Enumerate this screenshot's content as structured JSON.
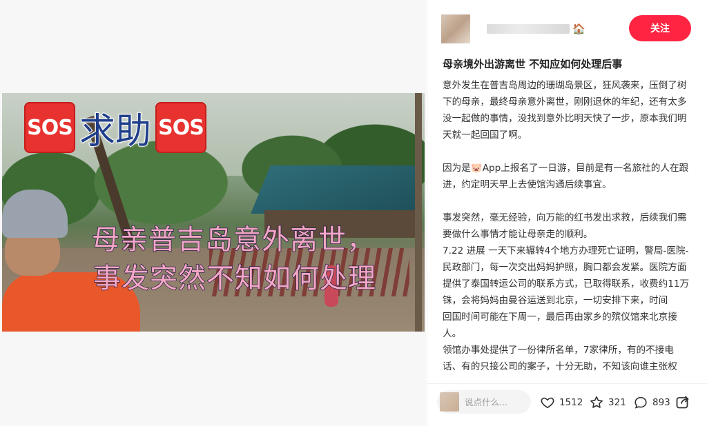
{
  "media": {
    "sos_badge": "SOS",
    "sos_text": "求助",
    "overlay_line1": "母亲普吉岛意外离世，",
    "overlay_line2": "事发突然不知如何处理"
  },
  "author": {
    "follow_label": "关注"
  },
  "post": {
    "title": "母亲境外出游离世 不知应如何处理后事",
    "paragraphs": [
      "意外发生在普吉岛周边的珊瑚岛景区，狂风袭来，压倒了树下的母亲，最终母亲意外离世，刚刚退休的年纪，还有太多没一起做的事情，没找到意外比明天快了一步，原本我们明天就一起回国了啊。",
      "因为是🐷App上报名了一日游，目前是有一名旅社的人在跟进，约定明天早上去使馆沟通后续事宜。",
      "事发突然，毫无经验，向万能的红书发出求救，后续我们需要做什么事情才能让母亲走的顺利。",
      "7.22 进展 一天下来辗转4个地方办理死亡证明，警局-医院-民政部门，每一次交出妈妈护照，胸口都会发紧。医院方面提供了泰国转运公司的联系方式，已取得联系，收费约11万铢，会将妈妈由曼谷运送到北京，一切安排下来，时间",
      "回国时间可能在下周一，最后再由家乡的殡仪馆来北京接人。",
      "领馆办事处提供了一份律所名单，7家律所，有的不接电话、有的只接公司的案子，十分无助，不知该向谁主张权利。"
    ]
  },
  "actions": {
    "comment_placeholder": "说点什么...",
    "likes": "1512",
    "stars": "321",
    "comments": "893",
    "accent_color": "#ff2442"
  }
}
